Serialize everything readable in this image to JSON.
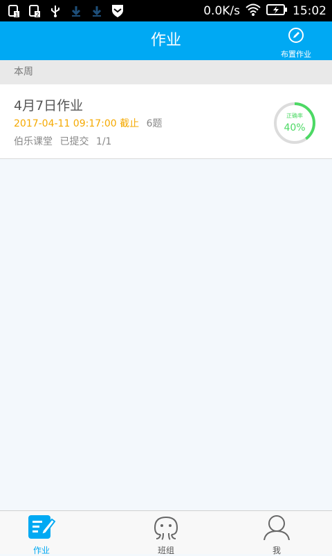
{
  "status_bar": {
    "speed": "0.0K/s",
    "time": "15:02"
  },
  "app_bar": {
    "title": "作业",
    "assign_label": "布置作业"
  },
  "section": {
    "label": "本周"
  },
  "homework": {
    "title": "4月7日作业",
    "deadline": "2017-04-11 09:17:00 截止",
    "question_count": "6题",
    "class_name": "伯乐课堂",
    "status": "已提交",
    "submitted": "1/1",
    "accuracy_label": "正确率",
    "accuracy_text": "40%",
    "accuracy": 0.4
  },
  "tabs": [
    {
      "label": "作业",
      "icon": "homework-icon",
      "active": true
    },
    {
      "label": "班组",
      "icon": "class-group-icon",
      "active": false
    },
    {
      "label": "我",
      "icon": "profile-icon",
      "active": false
    }
  ],
  "colors": {
    "primary": "#00a9f3",
    "deadline": "#f5a900",
    "ring_progress": "#4cd964"
  }
}
